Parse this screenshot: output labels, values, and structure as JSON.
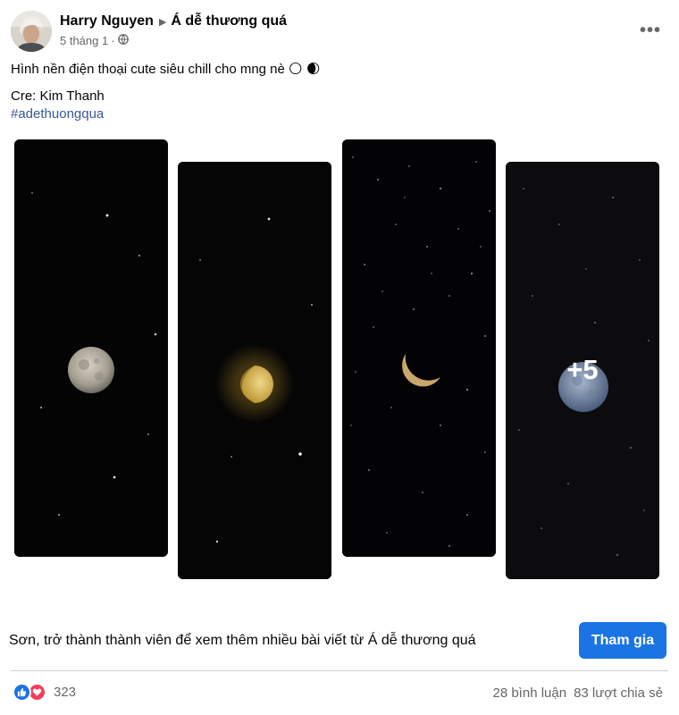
{
  "post": {
    "author": "Harry Nguyen",
    "group": "Á dễ thương quá",
    "time": "5 tháng 1",
    "separator": "·",
    "more_icon": "more-horizontal-icon",
    "privacy_icon": "globe-icon",
    "caption": "Hình nền điện thoại cute siêu chill cho mng nè 🌕 🌒",
    "credit": "Cre: Kim Thanh",
    "hashtag": "#adethuongqua",
    "photos": [
      {
        "name": "full-moon"
      },
      {
        "name": "half-moon"
      },
      {
        "name": "crescent-moon"
      },
      {
        "name": "blue-moon",
        "overlay": "+5"
      }
    ]
  },
  "join": {
    "text": "Sơn, trở thành thành viên để xem thêm nhiều bài viết từ Á dễ thương quá",
    "button": "Tham gia"
  },
  "footer": {
    "reaction_icons": [
      "like-icon",
      "love-icon"
    ],
    "reaction_count": "323",
    "comments": "28 bình luận",
    "shares": "83 lượt chia sẻ"
  },
  "colors": {
    "accent": "#1b74e4",
    "hashtag": "#385898",
    "secondary_text": "#65676b",
    "love": "#f33e58"
  }
}
